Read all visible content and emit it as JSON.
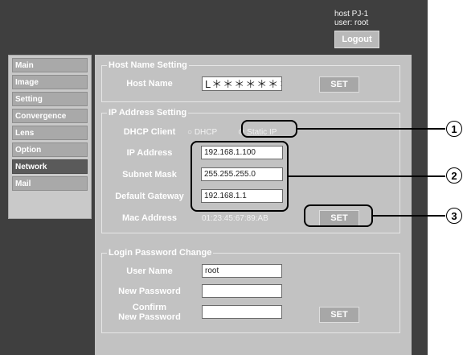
{
  "header": {
    "host_line": "host PJ-1",
    "user_line": "user: root",
    "logout_label": "Logout"
  },
  "sidebar": {
    "items": [
      {
        "label": "Main"
      },
      {
        "label": "Image"
      },
      {
        "label": "Setting"
      },
      {
        "label": "Convergence"
      },
      {
        "label": "Lens"
      },
      {
        "label": "Option"
      },
      {
        "label": "Network",
        "active": true
      },
      {
        "label": "Mail"
      }
    ]
  },
  "host_name_setting": {
    "legend": "Host Name Setting",
    "label": "Host Name",
    "value": "L＊＊＊＊＊＊＊",
    "set_label": "SET"
  },
  "ip_address_setting": {
    "legend": "IP Address Setting",
    "dhcp_client_label": "DHCP Client",
    "dhcp_option": "DHCP",
    "static_ip_option": "Static IP",
    "selected_option": "Static IP",
    "ip_address_label": "IP Address",
    "ip_address_value": "192.168.1.100",
    "subnet_mask_label": "Subnet Mask",
    "subnet_mask_value": "255.255.255.0",
    "default_gateway_label": "Default Gateway",
    "default_gateway_value": "192.168.1.1",
    "mac_address_label": "Mac Address",
    "mac_address_value": "01:23:45:67:89:AB",
    "set_label": "SET"
  },
  "login_password_change": {
    "legend": "Login Password Change",
    "user_name_label": "User Name",
    "user_name_value": "root",
    "new_password_label": "New Password",
    "new_password_value": "",
    "confirm_label_line1": "Confirm",
    "confirm_label_line2": "New Password",
    "confirm_value": "",
    "set_label": "SET"
  },
  "callouts": {
    "one": "1",
    "two": "2",
    "three": "3"
  }
}
